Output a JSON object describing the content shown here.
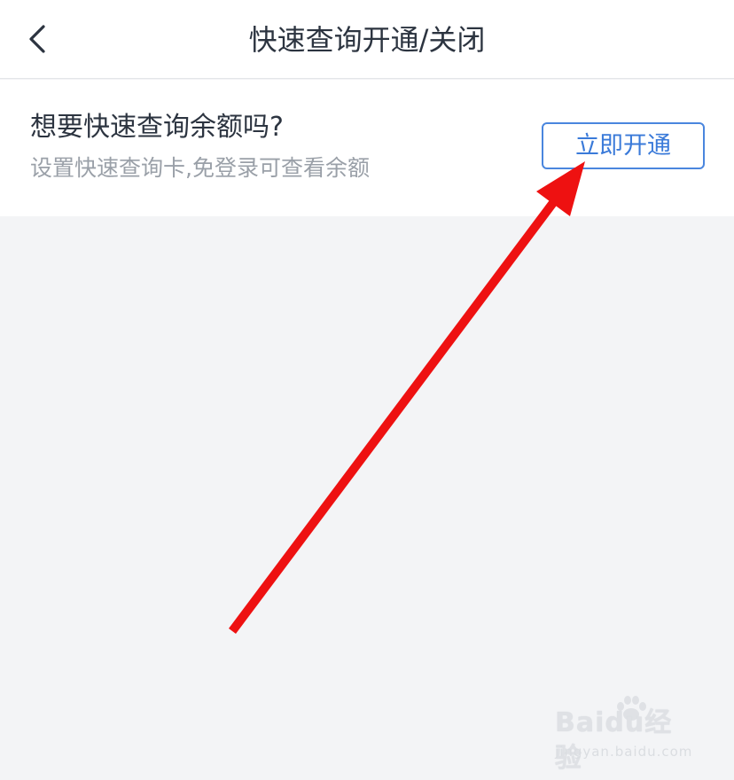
{
  "header": {
    "title": "快速查询开通/关闭",
    "back_icon": "chevron-left-icon"
  },
  "card": {
    "title": "想要快速查询余额吗?",
    "subtitle": "设置快速查询卡,免登录可查看余额",
    "button_label": "立即开通"
  },
  "annotation": {
    "arrow_color": "#ee1111"
  },
  "watermark": {
    "brand": "Baidu经验",
    "url": "jingyan.baidu.com"
  },
  "colors": {
    "background": "#f3f4f6",
    "surface": "#ffffff",
    "accent": "#3a7ad9",
    "text_primary": "#2c3440",
    "text_secondary": "#9aa0a8"
  }
}
